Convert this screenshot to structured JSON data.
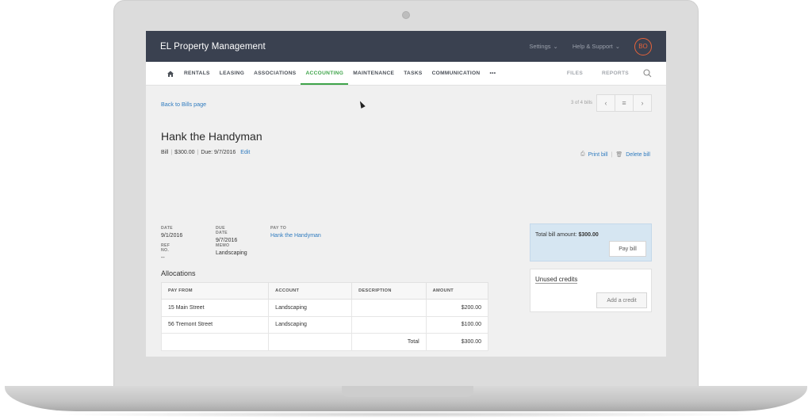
{
  "app": {
    "title": "EL Property Management",
    "settings_label": "Settings",
    "help_label": "Help & Support",
    "avatar_initials": "BO"
  },
  "nav": {
    "items": [
      "RENTALS",
      "LEASING",
      "ASSOCIATIONS",
      "ACCOUNTING",
      "MAINTENANCE",
      "TASKS",
      "COMMUNICATION"
    ],
    "more": "•••",
    "right_items": [
      "FILES",
      "REPORTS"
    ],
    "active": "ACCOUNTING"
  },
  "page": {
    "back_link": "Back to Bills page",
    "pager_text": "3 of 4 bills",
    "title": "Hank the Handyman",
    "sub_type": "Bill",
    "sub_amount": "$300.00",
    "sub_due": "Due: 9/7/2016",
    "edit_label": "Edit",
    "print_label": "Print bill",
    "delete_label": "Delete bill"
  },
  "fields": {
    "date_label": "DATE",
    "date_value": "9/1/2016",
    "due_label": "DUE DATE",
    "due_value": "9/7/2016",
    "payto_label": "PAY TO",
    "payto_value": "Hank the Handyman",
    "ref_label": "REF NO.",
    "ref_value": "--",
    "memo_label": "MEMO",
    "memo_value": "Landscaping"
  },
  "allocations": {
    "title": "Allocations",
    "headers": [
      "PAY FROM",
      "ACCOUNT",
      "DESCRIPTION",
      "AMOUNT"
    ],
    "rows": [
      {
        "pay_from": "15 Main Street",
        "account": "Landscaping",
        "description": "",
        "amount": "$200.00"
      },
      {
        "pay_from": "56 Tremont Street",
        "account": "Landscaping",
        "description": "",
        "amount": "$100.00"
      }
    ],
    "total_label": "Total",
    "total_value": "$300.00"
  },
  "summary": {
    "total_label": "Total bill amount:",
    "total_value": "$300.00",
    "pay_button": "Pay bill",
    "credits_title": "Unused credits",
    "add_credit_button": "Add a credit"
  }
}
